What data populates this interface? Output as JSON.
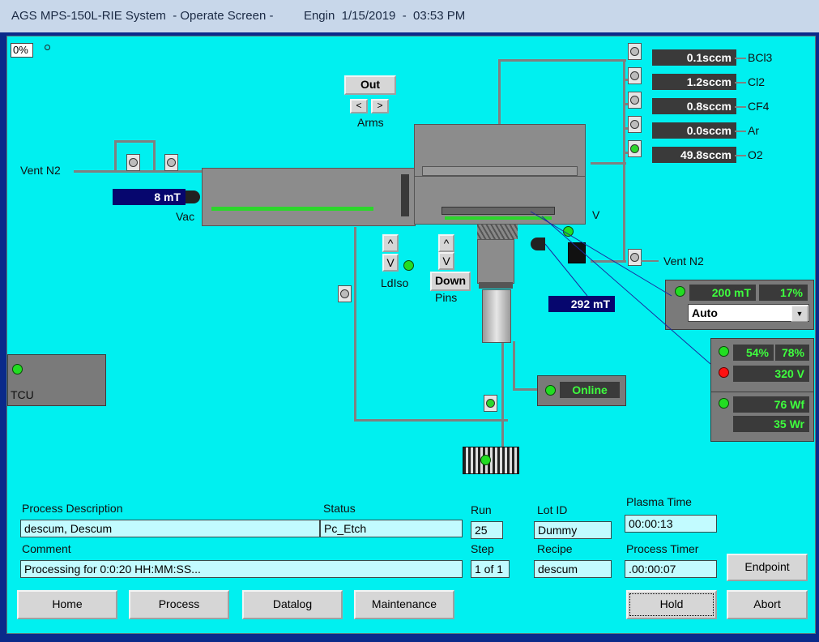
{
  "window": {
    "title": "AGS MPS-150L-RIE System  - Operate Screen -         Engin  1/15/2019  -  03:53 PM"
  },
  "top_left": {
    "percent": "0%"
  },
  "arms": {
    "state": "Out",
    "left": "<",
    "right": ">",
    "label": "Arms"
  },
  "vent_left": {
    "label": "Vent N2"
  },
  "vac": {
    "pressure": "8 mT",
    "label": "Vac"
  },
  "ldiso": {
    "up": "^",
    "down": "V",
    "label": "LdIso"
  },
  "pins": {
    "up": "^",
    "down": "V",
    "state": "Down",
    "label": "Pins"
  },
  "chamber": {
    "valve_label": "V",
    "pressure": "292 mT"
  },
  "vent_right": {
    "label": "Vent N2"
  },
  "gases": [
    {
      "value": "0.1sccm",
      "name": "BCl3"
    },
    {
      "value": "1.2sccm",
      "name": "Cl2"
    },
    {
      "value": "0.8sccm",
      "name": "CF4"
    },
    {
      "value": "0.0sccm",
      "name": "Ar"
    },
    {
      "value": "49.8sccm",
      "name": "O2"
    }
  ],
  "pressure_ctrl": {
    "setpoint": "200  mT",
    "percent": "17%",
    "mode": "Auto"
  },
  "rf_panel": {
    "load": "54%",
    "tune": "78%",
    "bias": "320 V",
    "forward": "76 Wf",
    "reflected": "35 Wr"
  },
  "pump": {
    "status": "Online"
  },
  "tcu": {
    "label": "TCU"
  },
  "info": {
    "process_description_label": "Process Description",
    "process_description": "descum, Descum",
    "status_label": "Status",
    "status": "Pc_Etch",
    "run_label": "Run",
    "run": "25",
    "lotid_label": "Lot ID",
    "lotid": "Dummy",
    "plasma_time_label": "Plasma Time",
    "plasma_time": "00:00:13",
    "comment_label": "Comment",
    "comment": "Processing for 0:0:20 HH:MM:SS...",
    "step_label": "Step",
    "step": "1 of 1",
    "recipe_label": "Recipe",
    "recipe": "descum",
    "process_timer_label": "Process Timer",
    "process_timer": ".00:00:07"
  },
  "buttons": {
    "endpoint": "Endpoint",
    "home": "Home",
    "process": "Process",
    "datalog": "Datalog",
    "maintenance": "Maintenance",
    "hold": "Hold",
    "abort": "Abort"
  }
}
